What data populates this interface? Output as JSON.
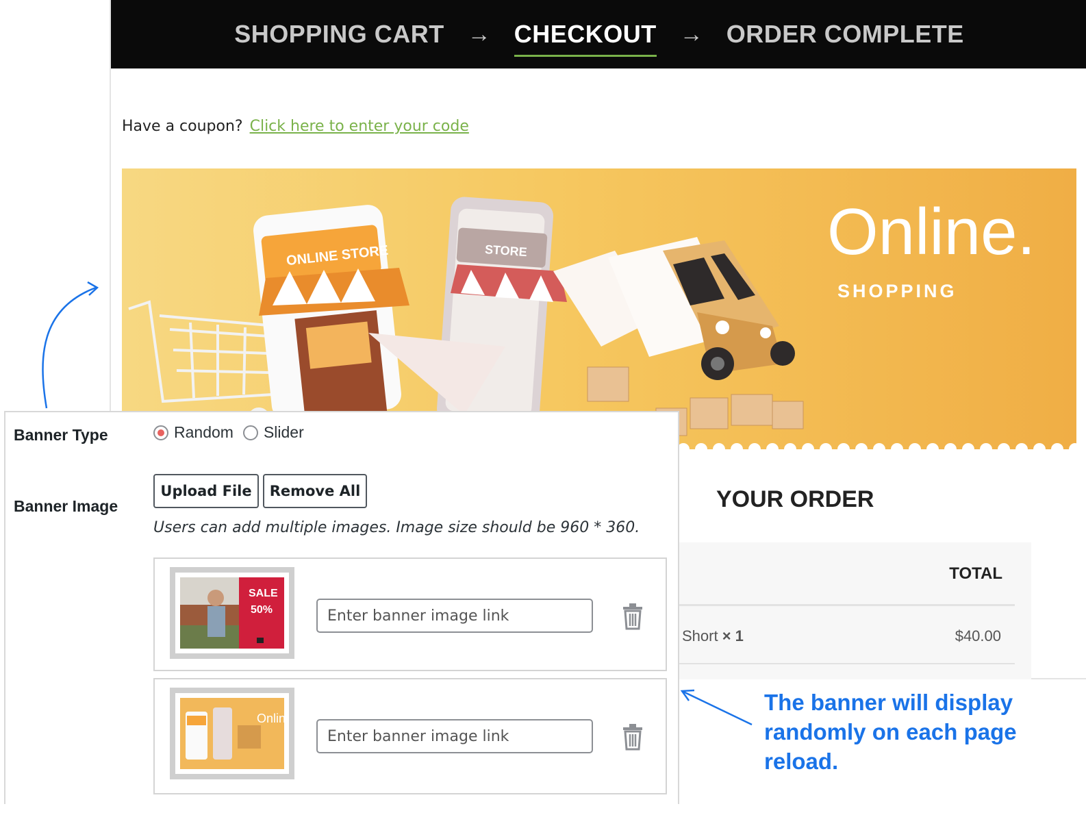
{
  "steps": [
    {
      "label": "SHOPPING CART",
      "active": false
    },
    {
      "label": "CHECKOUT",
      "active": true
    },
    {
      "label": "ORDER COMPLETE",
      "active": false
    }
  ],
  "step_arrow": "→",
  "coupon": {
    "prompt": "Have a coupon?",
    "link": "Click here to enter your code"
  },
  "banner": {
    "headline": "Online.",
    "subhead": "SHOPPING",
    "store_sign": "ONLINE STORE",
    "phone_sign": "STORE"
  },
  "order": {
    "title": "YOUR ORDER",
    "total_header": "TOTAL",
    "item_name": "Short",
    "item_qty": "× 1",
    "item_price": "$40.00"
  },
  "settings": {
    "banner_type_label": "Banner Type",
    "radio_random": "Random",
    "radio_slider": "Slider",
    "selected": "Random",
    "banner_image_label": "Banner Image",
    "upload_button": "Upload File",
    "remove_all_button": "Remove All",
    "hint": "Users can add multiple images. Image size should be 960 * 360.",
    "rows": [
      {
        "placeholder": "Enter banner image link",
        "thumb_sale": "SALE",
        "thumb_pct": "50%"
      },
      {
        "placeholder": "Enter banner image link",
        "thumb_text": "Online."
      }
    ]
  },
  "annotation": "The banner will display randomly on each page reload.",
  "colors": {
    "accent_green": "#7ab24a",
    "radio_checked": "#e8625f",
    "annotation_blue": "#1a73e8",
    "header_bg": "#0a0a0a"
  }
}
